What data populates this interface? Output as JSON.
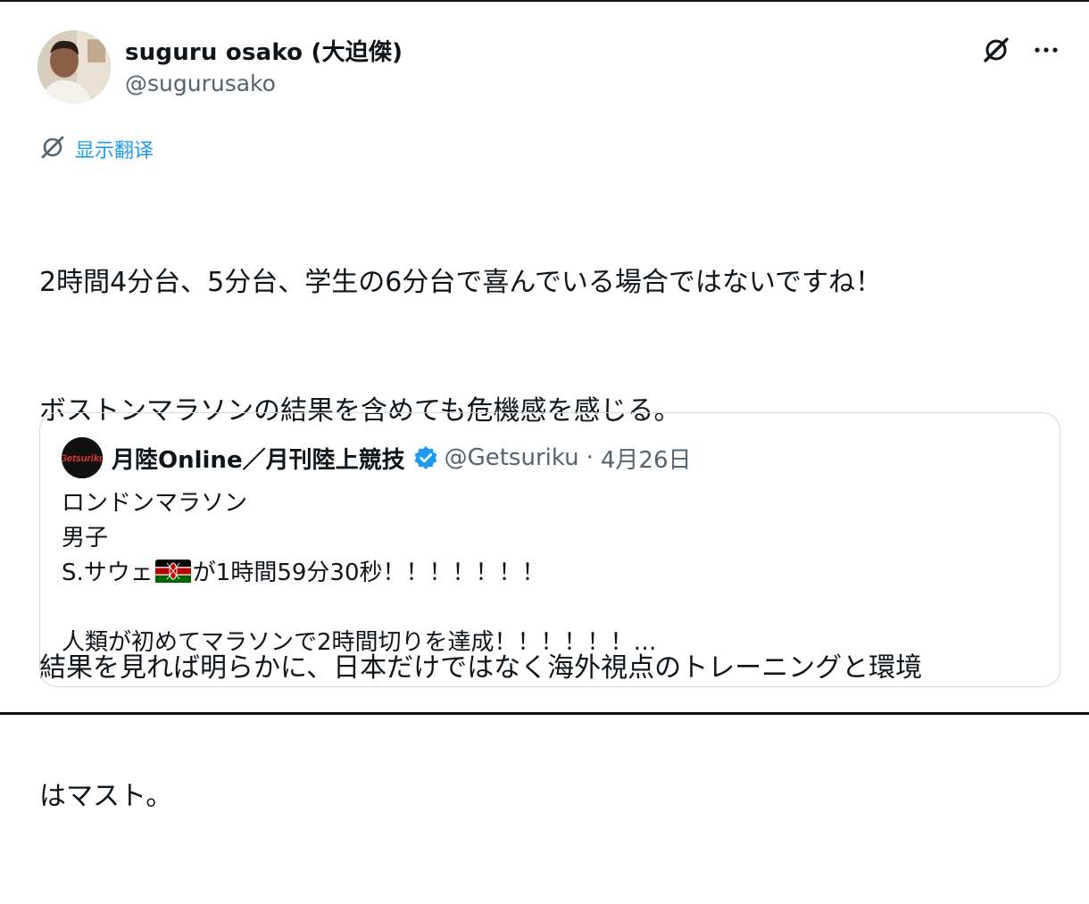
{
  "author": {
    "display_name": "suguru osako (大迫傑)",
    "handle": "@sugurusako"
  },
  "icons": {
    "avatar": "profile-photo",
    "grok": "grok-icon",
    "more": "more-horizontal-icon",
    "translate": "translate-icon",
    "verified": "verified-badge-icon",
    "flag": "kenya-flag-emoji"
  },
  "translate_label": "显示翻译",
  "tweet_lines": [
    "2時間4分台、5分台、学生の6分台で喜んでいる場合ではないですね！",
    "ボストンマラソンの結果を含めても危機感を感じる。",
    "",
    "結果を見れば明らかに、日本だけではなく海外視点のトレーニングと環境",
    "はマスト。"
  ],
  "quote": {
    "logo_text": "Getsuriku",
    "name": "月陸Online／月刊陸上競技",
    "handle": "@Getsuriku",
    "separator": "·",
    "date": "4月26日",
    "lines": {
      "line1": "ロンドンマラソン",
      "line2": "男子",
      "line3_pre": "S.サウェ",
      "line3_post": "が1時間59分30秒！！！！！！！",
      "line4": "",
      "line5": "人類が初めてマラソンで2時間切りを達成！！！！！！…"
    }
  },
  "colors": {
    "accent_blue": "#1d9bf0",
    "secondary_text": "#536471",
    "border": "#cfd9de"
  }
}
